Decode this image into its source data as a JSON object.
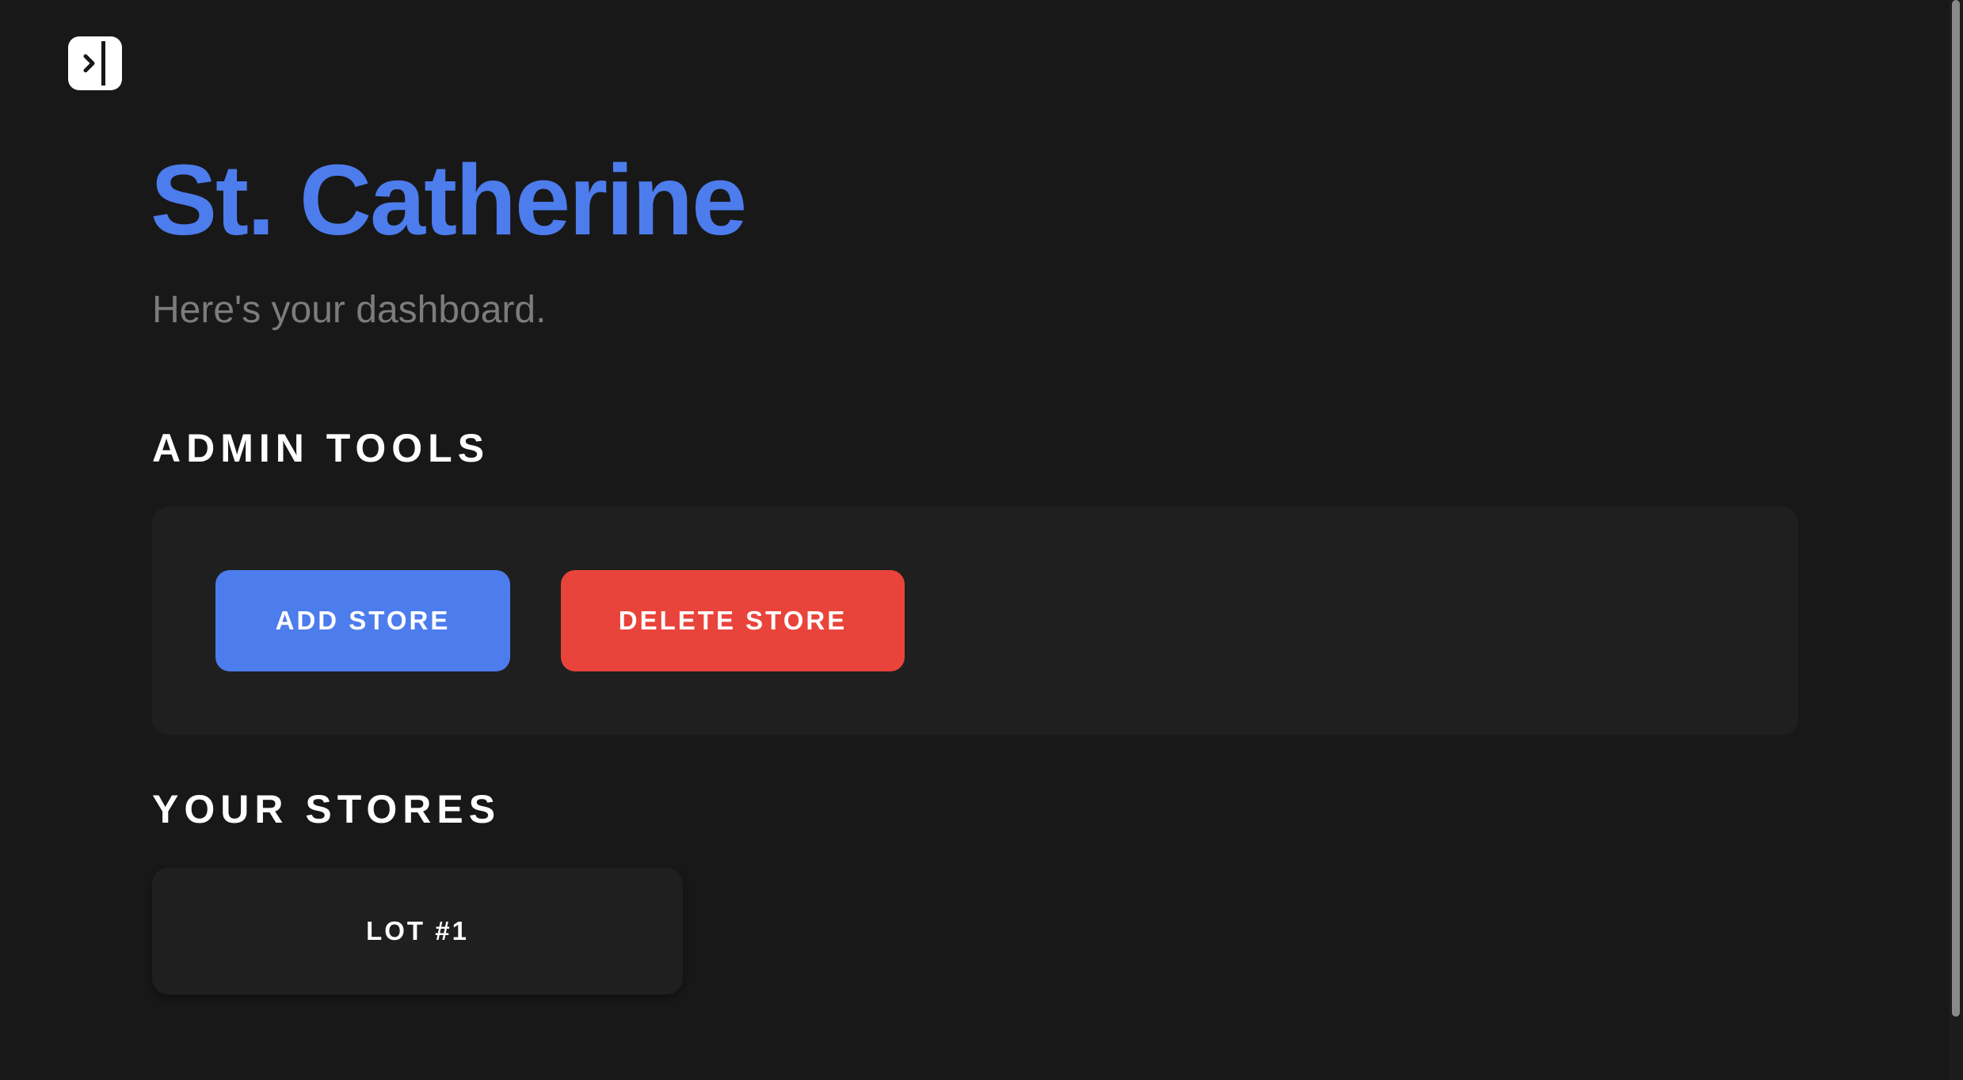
{
  "header": {
    "title": "St. Catherine",
    "subtitle": "Here's your dashboard.",
    "sidebar_toggle_icon": "chevron-right-sidebar-icon"
  },
  "admin_tools": {
    "heading": "ADMIN TOOLS",
    "add_store_label": "ADD STORE",
    "delete_store_label": "DELETE STORE"
  },
  "stores": {
    "heading": "YOUR STORES",
    "items": [
      {
        "label": "LOT #1"
      }
    ]
  },
  "colors": {
    "background": "#181818",
    "panel": "#1f1f1f",
    "accent_blue": "#4d7ced",
    "danger_red": "#e9443b",
    "muted_text": "#7c7c7c"
  }
}
